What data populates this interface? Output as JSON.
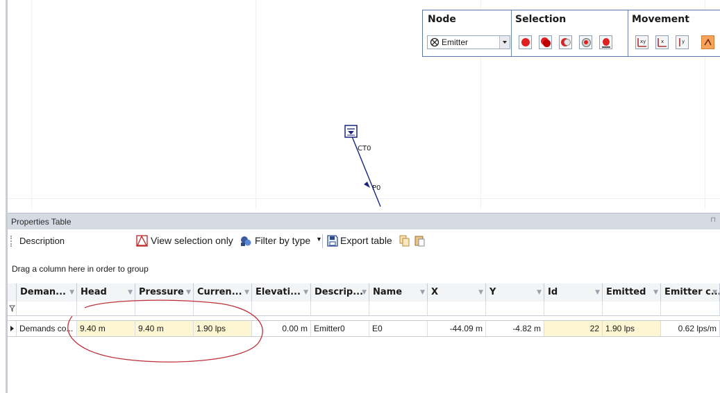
{
  "toolbar": {
    "node": {
      "title": "Node",
      "selected": "Emitter"
    },
    "selection": {
      "title": "Selection"
    },
    "movement": {
      "title": "Movement"
    }
  },
  "map": {
    "tank_label": "CT0",
    "pipe_label": "P0"
  },
  "panel": {
    "title": "Properties Table",
    "description_label": "Description",
    "view_selection": "View selection only",
    "filter_by_type": "Filter by type",
    "export_table": "Export table",
    "group_hint": "Drag a column here in order to group"
  },
  "table": {
    "columns": [
      "Deman...",
      "Head",
      "Pressure",
      "Curren...",
      "Elevati...",
      "Descrip...",
      "Name",
      "X",
      "Y",
      "Id",
      "Emitted",
      "Emitter c..."
    ],
    "row": [
      "Demands co...",
      "9.40 m",
      "9.40 m",
      "1.90 lps",
      "0.00 m",
      "Emitter0",
      "E0",
      "-44.09 m",
      "-4.82 m",
      "22",
      "1.90 lps",
      "0.62 lps/m"
    ]
  }
}
